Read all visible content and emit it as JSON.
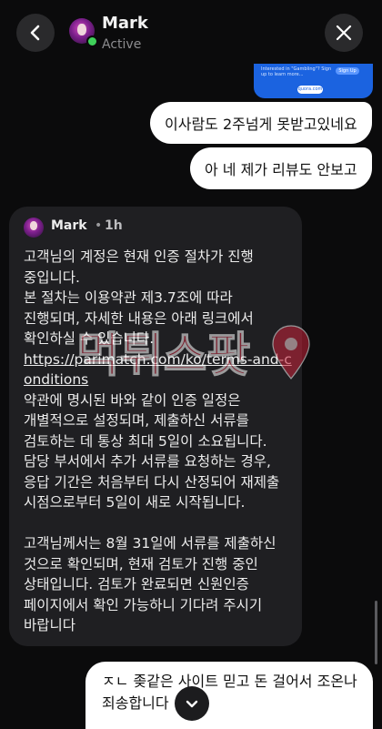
{
  "header": {
    "name": "Mark",
    "status": "Active"
  },
  "ad": {
    "text": "Interested in \"Gambling\"? Sign up to learn more...",
    "signup_label": "Sign Up",
    "cta_label": "quora.com"
  },
  "messages_out": [
    {
      "text": "이사람도 2주넘게 못받고있네요"
    },
    {
      "text": "아 네 제가 리뷰도 안보고"
    }
  ],
  "incoming": {
    "name": "Mark",
    "separator": "•",
    "time": "1h",
    "paragraphs": [
      "고객님의 계정은 현재 인증 절차가 진행 중입니다.",
      "본 절차는 이용약관 제3.7조에 따라 진행되며, 자세한 내용은 아래 링크에서 확인하실 수 있습니다.",
      "https://parimatch.com/ko/terms-and-conditions",
      "약관에 명시된 바와 같이 인증 일정은 개별적으로 설정되며, 제출하신 서류를 검토하는 데 통상 최대 5일이 소요됩니다. 담당 부서에서 추가 서류를 요청하는 경우, 응답 기간은 처음부터 다시 산정되어 재제출 시점으로부터 5일이 새로 시작됩니다.",
      "고객님께서는 8월 31일에 서류를 제출하신 것으로 확인되며, 현재 검토가 진행 중인 상태입니다. 검토가 완료되면 신원인증 페이지에서 확인 가능하니 기다려 주시기 바랍니다"
    ]
  },
  "last_out": {
    "text": "ㅈㄴ 좆같은 사이트 믿고 돈 걸어서 조온나 죄송합니다"
  },
  "watermark": {
    "text": "먹튀스팟"
  },
  "colors": {
    "background": "#0b0b0c",
    "bubble_out": "#ffffff",
    "bubble_in": "#1f1f22",
    "online": "#3fd15a",
    "ad_blue": "#1b63e0"
  }
}
